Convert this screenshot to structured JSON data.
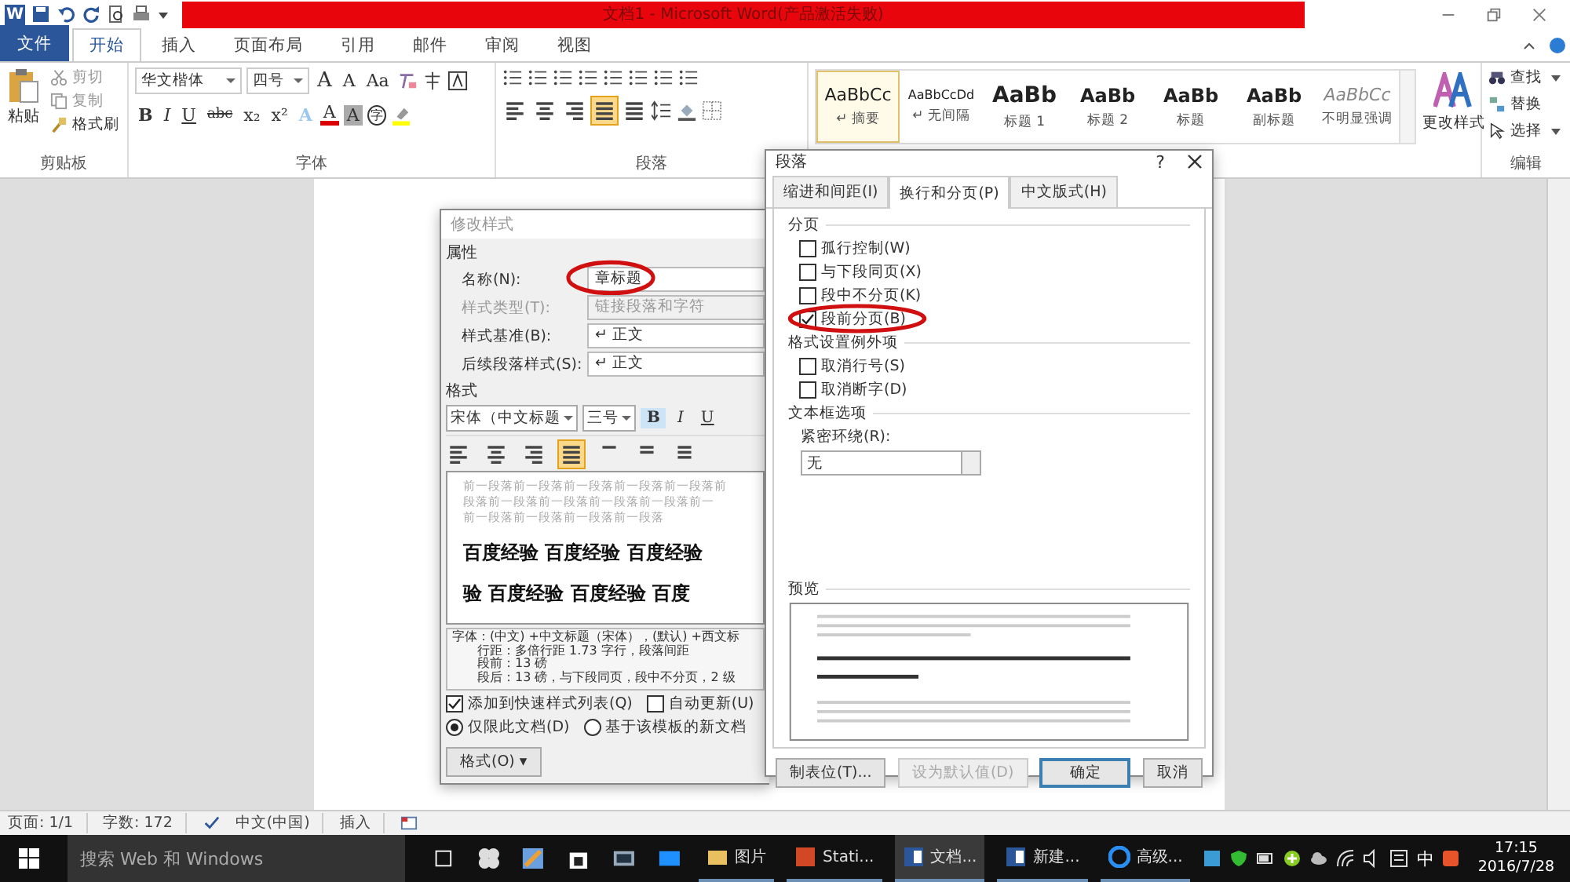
{
  "title_bar": {
    "logo": "W",
    "title": "文档1 - Microsoft Word(产品激活失败)"
  },
  "ribbon_tabs": [
    {
      "label": "文件",
      "kind": "file",
      "selected": false
    },
    {
      "label": "开始",
      "kind": "tab",
      "selected": true
    },
    {
      "label": "插入",
      "kind": "tab",
      "selected": false
    },
    {
      "label": "页面布局",
      "kind": "tab",
      "selected": false
    },
    {
      "label": "引用",
      "kind": "tab",
      "selected": false
    },
    {
      "label": "邮件",
      "kind": "tab",
      "selected": false
    },
    {
      "label": "审阅",
      "kind": "tab",
      "selected": false
    },
    {
      "label": "视图",
      "kind": "tab",
      "selected": false
    }
  ],
  "clipboard": {
    "paste": "粘贴",
    "cut": "剪切",
    "copy": "复制",
    "format_painter": "格式刷",
    "group": "剪贴板"
  },
  "font": {
    "font_name": "华文楷体",
    "font_size": "四号",
    "case_button": "Aa",
    "grow": "A",
    "shrink": "A",
    "tools": [
      {
        "label": "B",
        "kind": "bold"
      },
      {
        "label": "I",
        "kind": "italic"
      },
      {
        "label": "U",
        "kind": "underline"
      },
      {
        "label": "abc",
        "kind": "strike"
      },
      {
        "label": "x₂",
        "kind": "plain"
      },
      {
        "label": "x²",
        "kind": "plain"
      },
      {
        "label": "A",
        "kind": "effects"
      },
      {
        "label": "A",
        "kind": "color"
      },
      {
        "label": "A",
        "kind": "shade"
      },
      {
        "label": "字",
        "kind": "enclosed"
      }
    ],
    "group": "字体"
  },
  "paragraph": {
    "alignment": [
      {
        "kind": "left",
        "selected": false
      },
      {
        "kind": "center",
        "selected": false
      },
      {
        "kind": "right",
        "selected": false
      },
      {
        "kind": "justify",
        "selected": true
      },
      {
        "kind": "distributed",
        "selected": false
      }
    ],
    "group": "段落"
  },
  "styles": [
    {
      "preview": "AaBbCc",
      "label": "↵ 摘要",
      "kind": "normal",
      "selected": true
    },
    {
      "preview": "AaBbCcDd",
      "label": "↵ 无间隔",
      "kind": "small",
      "selected": false
    },
    {
      "preview": "AaBb",
      "label": "标题 1",
      "kind": "heading1",
      "selected": false
    },
    {
      "preview": "AaBb",
      "label": "标题 2",
      "kind": "heading",
      "selected": false
    },
    {
      "preview": "AaBb",
      "label": "标题",
      "kind": "heading",
      "selected": false
    },
    {
      "preview": "AaBb",
      "label": "副标题",
      "kind": "heading",
      "selected": false
    },
    {
      "preview": "AaBbCc",
      "label": "不明显强调",
      "kind": "subtle",
      "selected": false
    }
  ],
  "change_styles": "更改样式",
  "editing": {
    "find": "查找",
    "replace": "替换",
    "select": "选择",
    "group": "编辑"
  },
  "modify_style_dialog": {
    "title": "修改样式",
    "properties_heading": "属性",
    "fields": [
      {
        "label": "名称(N):",
        "value": "章标题",
        "disabled": false,
        "circled": true
      },
      {
        "label": "样式类型(T):",
        "value": "链接段落和字符",
        "disabled": true,
        "circled": false
      },
      {
        "label": "样式基准(B):",
        "value": "↵ 正文",
        "disabled": false,
        "circled": false
      },
      {
        "label": "后续段落样式(S):",
        "value": "↵ 正文",
        "disabled": false,
        "circled": false
      }
    ],
    "format_heading": "格式",
    "font": "宋体（中文标题",
    "size": "三号",
    "format_tools": [
      {
        "label": "B",
        "kind": "bold",
        "selected": true
      },
      {
        "label": "I",
        "kind": "italic",
        "selected": false
      },
      {
        "label": "U",
        "kind": "underline",
        "selected": false
      }
    ],
    "alignment": [
      {
        "kind": "left",
        "selected": false
      },
      {
        "kind": "center",
        "selected": false
      },
      {
        "kind": "right",
        "selected": false
      },
      {
        "kind": "justify",
        "selected": true
      },
      {
        "kind": "one",
        "selected": false
      },
      {
        "kind": "two",
        "selected": false
      },
      {
        "kind": "three",
        "selected": false
      }
    ],
    "preview_previous": [
      "前一段落前一段落前一段落前一段落前一段落前",
      "段落前一段落前一段落前一段落前一段落前一",
      "前一段落前一段落前一段落前一段落"
    ],
    "preview_sample": [
      "百度经验 百度经验 百度经验",
      "验 百度经验 百度经验 百度"
    ],
    "description": [
      "字体：(中文) +中文标题（宋体），(默认) +西文标",
      "行距：多倍行距 1.73 字行，段落间距",
      "段前：13 磅",
      "段后：13 磅，与下段同页，段中不分页，2 级"
    ],
    "checkboxes": [
      {
        "label": "添加到快速样式列表(Q)",
        "checked": true
      },
      {
        "label": "自动更新(U)",
        "checked": false
      }
    ],
    "radios": [
      {
        "label": "仅限此文档(D)",
        "selected": true
      },
      {
        "label": "基于该模板的新文档",
        "selected": false
      }
    ],
    "format_button": "格式(O) ▾"
  },
  "paragraph_dialog": {
    "title": "段落",
    "help": "?",
    "tabs": [
      {
        "label": "缩进和间距(I)",
        "selected": false
      },
      {
        "label": "换行和分页(P)",
        "selected": true
      },
      {
        "label": "中文版式(H)",
        "selected": false
      }
    ],
    "sections": [
      {
        "heading": "分页",
        "options": [
          {
            "label": "孤行控制(W)",
            "checked": false,
            "circled": false
          },
          {
            "label": "与下段同页(X)",
            "checked": false,
            "circled": false
          },
          {
            "label": "段中不分页(K)",
            "checked": false,
            "circled": false
          },
          {
            "label": "段前分页(B)",
            "checked": true,
            "circled": true
          }
        ]
      },
      {
        "heading": "格式设置例外项",
        "options": [
          {
            "label": "取消行号(S)",
            "checked": false,
            "circled": false
          },
          {
            "label": "取消断字(D)",
            "checked": false,
            "circled": false
          }
        ]
      }
    ],
    "textbox_heading": "文本框选项",
    "wrap_label": "紧密环绕(R):",
    "wrap_value": "无",
    "preview_heading": "预览",
    "buttons": [
      {
        "label": "制表位(T)...",
        "disabled": false,
        "default": false
      },
      {
        "label": "设为默认值(D)",
        "disabled": true,
        "default": false
      },
      {
        "label": "确定",
        "disabled": false,
        "default": true
      },
      {
        "label": "取消",
        "disabled": false,
        "default": false
      }
    ]
  },
  "status_bar": [
    "页面: 1/1",
    "字数: 172",
    "中文(中国)",
    "插入"
  ],
  "taskbar": {
    "search_placeholder": "搜索 Web 和 Windows",
    "apps": [
      {
        "label": "图片",
        "active": false
      },
      {
        "label": "Stati...",
        "active": false
      },
      {
        "label": "文档...",
        "active": true
      },
      {
        "label": "新建...",
        "active": false
      },
      {
        "label": "高级...",
        "active": false
      }
    ],
    "ime": "中",
    "time": "17:15",
    "date": "2016/7/28"
  }
}
